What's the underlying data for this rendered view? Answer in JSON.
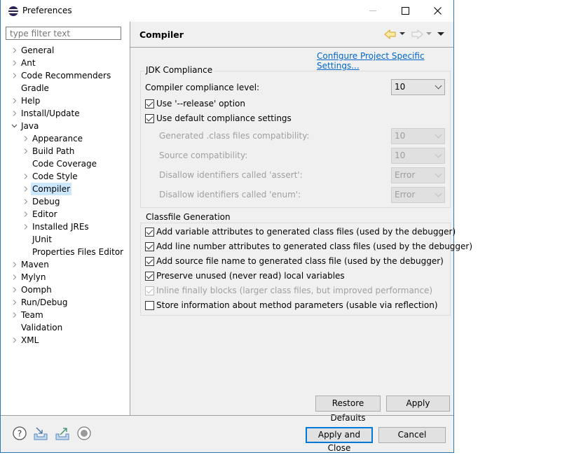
{
  "window": {
    "title": "Preferences",
    "icon": "eclipse-icon",
    "controls": [
      "minimize-icon",
      "maximize-icon",
      "close-icon"
    ]
  },
  "filter": {
    "placeholder": "type filter text",
    "value": ""
  },
  "tree": {
    "items": [
      {
        "label": "General",
        "level": 0,
        "expandable": true,
        "expanded": false
      },
      {
        "label": "Ant",
        "level": 0,
        "expandable": true,
        "expanded": false
      },
      {
        "label": "Code Recommenders",
        "level": 0,
        "expandable": true,
        "expanded": false
      },
      {
        "label": "Gradle",
        "level": 0,
        "expandable": false
      },
      {
        "label": "Help",
        "level": 0,
        "expandable": true,
        "expanded": false
      },
      {
        "label": "Install/Update",
        "level": 0,
        "expandable": true,
        "expanded": false
      },
      {
        "label": "Java",
        "level": 0,
        "expandable": true,
        "expanded": true
      },
      {
        "label": "Appearance",
        "level": 1,
        "expandable": true,
        "expanded": false
      },
      {
        "label": "Build Path",
        "level": 1,
        "expandable": true,
        "expanded": false
      },
      {
        "label": "Code Coverage",
        "level": 1,
        "expandable": false
      },
      {
        "label": "Code Style",
        "level": 1,
        "expandable": true,
        "expanded": false
      },
      {
        "label": "Compiler",
        "level": 1,
        "expandable": true,
        "expanded": false,
        "selected": true
      },
      {
        "label": "Debug",
        "level": 1,
        "expandable": true,
        "expanded": false
      },
      {
        "label": "Editor",
        "level": 1,
        "expandable": true,
        "expanded": false
      },
      {
        "label": "Installed JREs",
        "level": 1,
        "expandable": true,
        "expanded": false
      },
      {
        "label": "JUnit",
        "level": 1,
        "expandable": false
      },
      {
        "label": "Properties Files Editor",
        "level": 1,
        "expandable": false
      },
      {
        "label": "Maven",
        "level": 0,
        "expandable": true,
        "expanded": false
      },
      {
        "label": "Mylyn",
        "level": 0,
        "expandable": true,
        "expanded": false
      },
      {
        "label": "Oomph",
        "level": 0,
        "expandable": true,
        "expanded": false
      },
      {
        "label": "Run/Debug",
        "level": 0,
        "expandable": true,
        "expanded": false
      },
      {
        "label": "Team",
        "level": 0,
        "expandable": true,
        "expanded": false
      },
      {
        "label": "Validation",
        "level": 0,
        "expandable": false
      },
      {
        "label": "XML",
        "level": 0,
        "expandable": true,
        "expanded": false
      }
    ]
  },
  "page": {
    "title": "Compiler",
    "nav": {
      "back": "back-arrow-icon",
      "forward": "forward-arrow-icon",
      "menu": "view-menu-icon"
    },
    "project_link": "Configure Project Specific Settings...",
    "jdk": {
      "title": "JDK Compliance",
      "compliance_label": "Compiler compliance level:",
      "compliance_value": "10",
      "release_option": {
        "label": "Use '--release' option",
        "checked": true
      },
      "default_settings": {
        "label": "Use default compliance settings",
        "checked": true
      },
      "disabled_rows": [
        {
          "label": "Generated .class files compatibility:",
          "value": "10"
        },
        {
          "label": "Source compatibility:",
          "value": "10"
        },
        {
          "label": "Disallow identifiers called 'assert':",
          "value": "Error"
        },
        {
          "label": "Disallow identifiers called 'enum':",
          "value": "Error"
        }
      ]
    },
    "classfile": {
      "title": "Classfile Generation",
      "options": [
        {
          "label": "Add variable attributes to generated class files (used by the debugger)",
          "checked": true,
          "enabled": true
        },
        {
          "label": "Add line number attributes to generated class files (used by the debugger)",
          "checked": true,
          "enabled": true
        },
        {
          "label": "Add source file name to generated class file (used by the debugger)",
          "checked": true,
          "enabled": true
        },
        {
          "label": "Preserve unused (never read) local variables",
          "checked": true,
          "enabled": true
        },
        {
          "label": "Inline finally blocks (larger class files, but improved performance)",
          "checked": true,
          "enabled": false
        },
        {
          "label": "Store information about method parameters (usable via reflection)",
          "checked": false,
          "enabled": true
        }
      ]
    },
    "buttons": {
      "restore_defaults": "Restore Defaults",
      "apply": "Apply"
    }
  },
  "footer": {
    "icons": [
      "help-icon",
      "import-icon",
      "export-icon",
      "record-icon"
    ],
    "apply_and_close": "Apply and Close",
    "cancel": "Cancel"
  },
  "colors": {
    "accent": "#0078d7",
    "link": "#0066cc",
    "selection": "#cce8ff",
    "window_border": "#2b7ab8"
  }
}
